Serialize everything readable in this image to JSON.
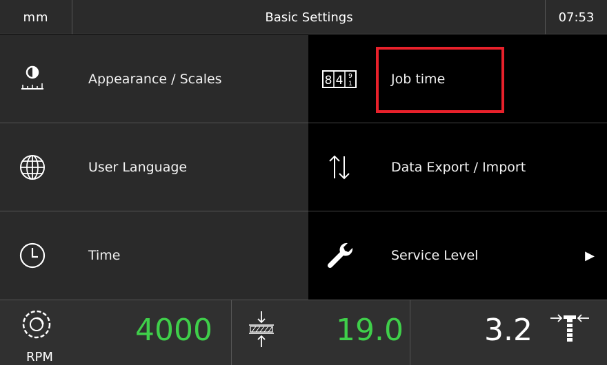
{
  "header": {
    "unit": "mm",
    "title": "Basic Settings",
    "time": "07:53"
  },
  "menu": {
    "appearance": {
      "label": "Appearance / Scales",
      "icon": "brightness-scale-icon"
    },
    "language": {
      "label": "User Language",
      "icon": "globe-icon"
    },
    "time": {
      "label": "Time",
      "icon": "clock-icon"
    },
    "jobtime": {
      "label": "Job time",
      "icon": "counter-icon",
      "counter_digits": "84",
      "highlighted": true
    },
    "data": {
      "label": "Data Export / Import",
      "icon": "up-down-arrows-icon"
    },
    "service": {
      "label": "Service Level",
      "icon": "wrench-icon"
    }
  },
  "status": {
    "rpm_value": "4000",
    "rpm_label": "RPM",
    "thickness_value": "19.0",
    "fence_value": "3.2"
  },
  "colors": {
    "highlight": "#e8212b",
    "value_green": "#3fcf4a"
  }
}
